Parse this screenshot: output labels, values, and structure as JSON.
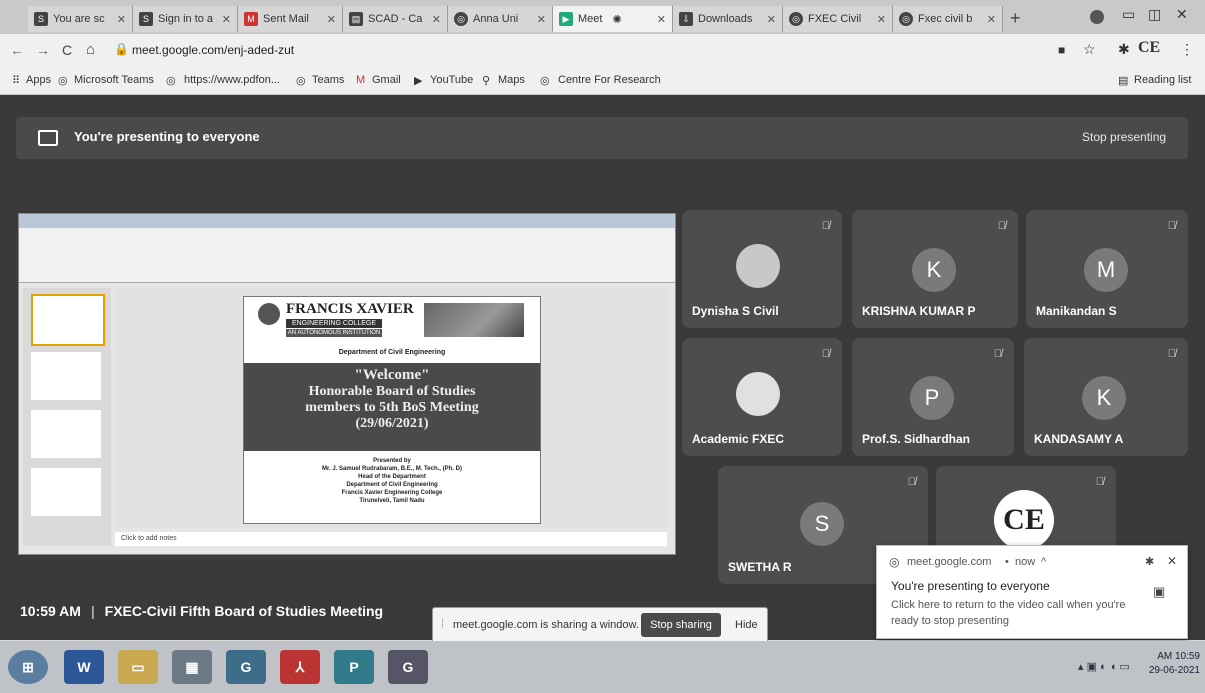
{
  "tabs": [
    {
      "icon": "s-icon",
      "label": "You are sc"
    },
    {
      "icon": "s-icon",
      "label": "Sign in to a"
    },
    {
      "icon": "gmail-icon",
      "label": "Sent Mail"
    },
    {
      "icon": "doc-icon",
      "label": "SCAD - Ca"
    },
    {
      "icon": "globe-icon",
      "label": "Anna Uni"
    },
    {
      "icon": "meet-icon",
      "label": "Meet"
    },
    {
      "icon": "download-icon",
      "label": "Downloads"
    },
    {
      "icon": "globe-icon",
      "label": "FXEC Civil"
    },
    {
      "icon": "globe-icon",
      "label": "Fxec civil b"
    }
  ],
  "address": {
    "url": "meet.google.com/enj-aded-zut"
  },
  "profile": "CE",
  "bookmarks": [
    "Apps",
    "Microsoft Teams",
    "https://www.pdfon...",
    "Teams",
    "Gmail",
    "YouTube",
    "Maps",
    "Centre For Research"
  ],
  "reading_list": "Reading list",
  "presenting": {
    "text": "You're presenting to everyone",
    "stop": "Stop presenting"
  },
  "slide": {
    "college": "FRANCIS XAVIER",
    "sub1": "ENGINEERING COLLEGE",
    "sub2": "AN AUTONOMOUS INSTITUTION",
    "dept": "Department of Civil Engineering",
    "welcome": "\"Welcome\"",
    "line2": "Honorable Board of Studies",
    "line3": "members to 5th BoS Meeting",
    "line4": "(29/06/2021)",
    "presented": "Presented by",
    "p1": "Mr. J. Samuel Rudrabaram, B.E., M. Tech., (Ph. D)",
    "p2": "Head of the Department",
    "p3": "Department of Civil Engineering",
    "p4": "Francis Xavier Engineering College",
    "p5": "Tirunelveli, Tamil Nadu",
    "notes": "Click to add notes"
  },
  "participants": [
    {
      "name": "Dynisha S Civil",
      "initial": ""
    },
    {
      "name": "KRISHNA KUMAR P",
      "initial": "K"
    },
    {
      "name": "Manikandan S",
      "initial": "M"
    },
    {
      "name": "Academic FXEC",
      "initial": ""
    },
    {
      "name": "Prof.S. Sidhardhan",
      "initial": "P"
    },
    {
      "name": "KANDASAMY A",
      "initial": "K"
    },
    {
      "name": "SWETHA R",
      "initial": "S"
    },
    {
      "name": "",
      "initial": "CE"
    }
  ],
  "meeting": {
    "time": "10:59 AM",
    "title": "FXEC-Civil Fifth Board of Studies Meeting"
  },
  "share": {
    "text": "meet.google.com is sharing a window.",
    "stop": "Stop sharing",
    "hide": "Hide"
  },
  "notification": {
    "source": "meet.google.com",
    "when": "now",
    "title": "You're presenting to everyone",
    "body": "Click here to return to the video call when you're ready to stop presenting"
  },
  "clock": {
    "time": "AM 10:59",
    "date": "29-06-2021"
  },
  "taskbar_apps": [
    "start",
    "word",
    "explorer",
    "calc",
    "chrome",
    "acrobat",
    "publisher",
    "chrome2"
  ]
}
